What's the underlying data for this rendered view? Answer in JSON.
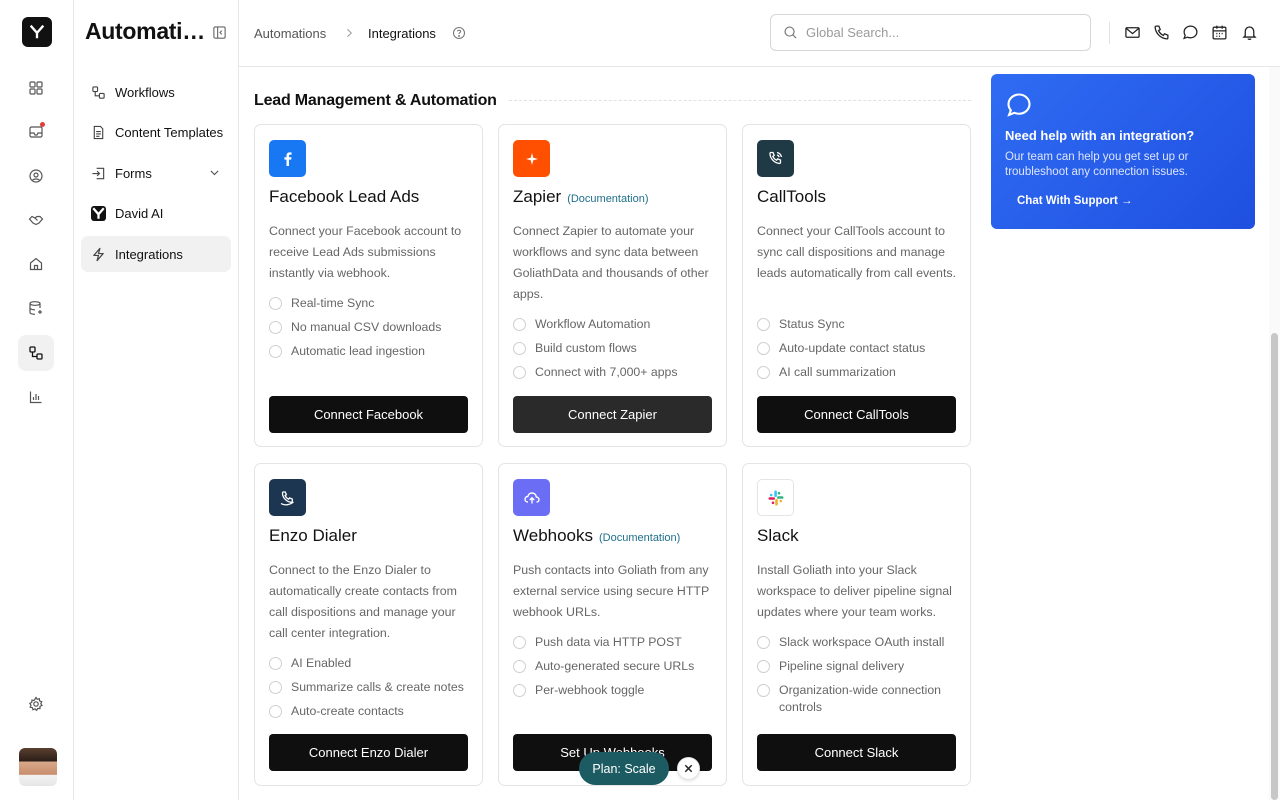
{
  "sidebar": {
    "title": "Automations",
    "items": [
      {
        "label": "Workflows",
        "icon": "workflow-icon"
      },
      {
        "label": "Content Templates",
        "icon": "document-icon"
      },
      {
        "label": "Forms",
        "icon": "forms-icon"
      },
      {
        "label": "David AI",
        "icon": "david-ai-logo"
      },
      {
        "label": "Integrations",
        "icon": "lightning-icon",
        "active": true
      }
    ]
  },
  "rail": {
    "items": [
      "dashboard-icon",
      "inbox-icon",
      "contacts-icon",
      "handshake-icon",
      "home-icon",
      "database-icon",
      "automations-icon",
      "analytics-icon",
      "settings-icon"
    ]
  },
  "breadcrumb": {
    "items": [
      "Automations",
      "Integrations"
    ]
  },
  "search": {
    "placeholder": "Global Search..."
  },
  "main": {
    "section_title": "Lead Management & Automation",
    "cards": [
      {
        "title": "Facebook Lead Ads",
        "doc": "",
        "description": "Connect your Facebook account to receive Lead Ads submissions instantly via webhook.",
        "features": [
          "Real-time Sync",
          "No manual CSV downloads",
          "Automatic lead ingestion"
        ],
        "button": "Connect Facebook",
        "color": "#1877f2"
      },
      {
        "title": "Zapier",
        "doc": "(Documentation)",
        "description": "Connect Zapier to automate your workflows and sync data between GoliathData and thousands of other apps.",
        "features": [
          "Workflow Automation",
          "Build custom flows",
          "Connect with 7,000+ apps"
        ],
        "button": "Connect Zapier",
        "color": "#ff4f00"
      },
      {
        "title": "CallTools",
        "doc": "",
        "description": "Connect your CallTools account to sync call dispositions and manage leads automatically from call events.",
        "features": [
          "Status Sync",
          "Auto-update contact status",
          "AI call summarization"
        ],
        "button": "Connect CallTools",
        "color": "#1f3a44"
      },
      {
        "title": "Enzo Dialer",
        "doc": "",
        "description": "Connect to the Enzo Dialer to automatically create contacts from call dispositions and manage your call center integration.",
        "features": [
          "AI Enabled",
          "Summarize calls & create notes",
          "Auto-create contacts"
        ],
        "button": "Connect Enzo Dialer",
        "color": "#1c3550"
      },
      {
        "title": "Webhooks",
        "doc": "(Documentation)",
        "description": "Push contacts into Goliath from any external service using secure HTTP webhook URLs.",
        "features": [
          "Push data via HTTP POST",
          "Auto-generated secure URLs",
          "Per-webhook toggle"
        ],
        "button": "Set Up Webhooks",
        "color": "#6b6ef5"
      },
      {
        "title": "Slack",
        "doc": "",
        "description": "Install Goliath into your Slack workspace to deliver pipeline signal updates where your team works.",
        "features": [
          "Slack workspace OAuth install",
          "Pipeline signal delivery",
          "Organization-wide connection controls"
        ],
        "button": "Connect Slack",
        "color": "#ffffff"
      }
    ]
  },
  "help": {
    "title": "Need help with an integration?",
    "text": "Our team can help you get set up or troubleshoot any connection issues.",
    "link": "Chat With Support →"
  },
  "plan": {
    "label": "Plan: Scale"
  },
  "colors": {
    "accent": "#2f6cf3",
    "plan": "#1d5b63",
    "button": "#0f0f0f"
  }
}
